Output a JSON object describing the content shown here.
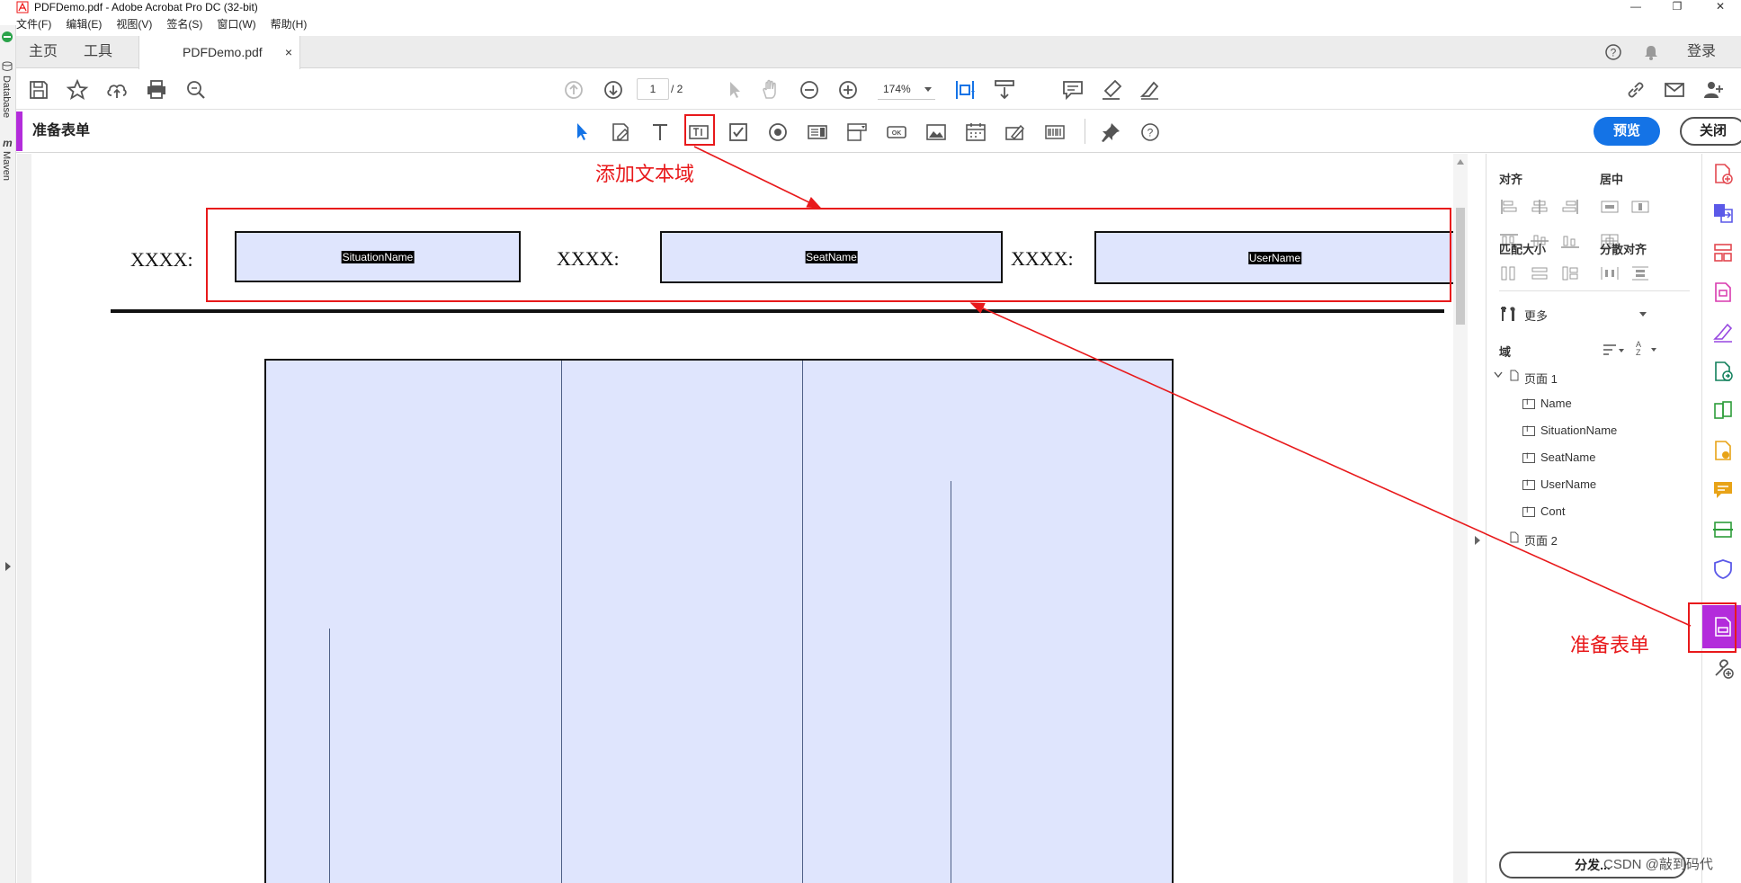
{
  "window": {
    "title": "PDFDemo.pdf - Adobe Acrobat Pro DC (32-bit)",
    "minimize": "—",
    "restore": "❐",
    "close": "✕"
  },
  "menu": [
    "文件(F)",
    "编辑(E)",
    "视图(V)",
    "签名(S)",
    "窗口(W)",
    "帮助(H)"
  ],
  "tabs": {
    "home": "主页",
    "tools": "工具",
    "doc": "PDFDemo.pdf",
    "close": "×",
    "login": "登录"
  },
  "toolbar": {
    "page_current": "1",
    "page_total": "/ 2",
    "zoom": "174%"
  },
  "formbar": {
    "title": "准备表单",
    "preview": "预览",
    "close": "关闭"
  },
  "left_strip": {
    "database": "Database",
    "maven": "Maven",
    "m": "m"
  },
  "document": {
    "label1": "XXXX:",
    "label2": "XXXX:",
    "label3": "XXXX:",
    "field1": "SituationName",
    "field2": "SeatName",
    "field3": "UserName"
  },
  "panel": {
    "align": "对齐",
    "center": "居中",
    "match_size": "匹配大小",
    "distribute": "分散对齐",
    "more": "更多",
    "fields": "域",
    "page1": "页面 1",
    "items": [
      "Name",
      "SituationName",
      "SeatName",
      "UserName",
      "Cont"
    ],
    "page2": "页面 2",
    "distribute_btn": "分发..."
  },
  "annotations": {
    "add_text_field": "添加文本域",
    "prepare_form": "准备表单",
    "color": "#e8191b"
  },
  "watermark": "CSDN @敲到码代",
  "colors": {
    "accent": "#b32cdb",
    "primary": "#1473e6",
    "field_fill": "#dfe5fd"
  }
}
